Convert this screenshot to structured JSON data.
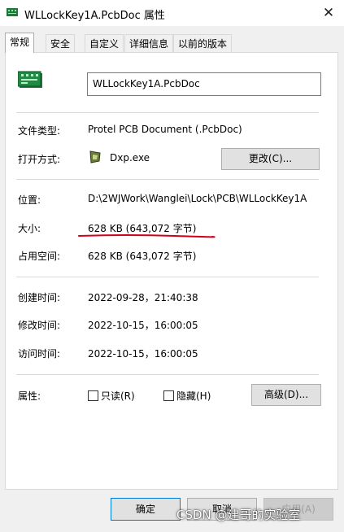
{
  "window": {
    "title": "WLLockKey1A.PcbDoc 属性",
    "close_glyph": "✕"
  },
  "tabs": [
    {
      "label": "常规"
    },
    {
      "label": "安全"
    },
    {
      "label": "自定义"
    },
    {
      "label": "详细信息"
    },
    {
      "label": "以前的版本"
    }
  ],
  "file": {
    "name": "WLLockKey1A.PcbDoc",
    "icon": "pcb-document-icon"
  },
  "general": {
    "type_label": "文件类型:",
    "type_value": "Protel PCB Document (.PcbDoc)",
    "opens_with_label": "打开方式:",
    "opens_with_value": "Dxp.exe",
    "opens_with_icon": "dxp-app-icon",
    "change_button": "更改(C)...",
    "location_label": "位置:",
    "location_value": "D:\\2WJWork\\Wanglei\\Lock\\PCB\\WLLockKey1A",
    "size_label": "大小:",
    "size_value": "628 KB (643,072 字节)",
    "size_on_disk_label": "占用空间:",
    "size_on_disk_value": "628 KB (643,072 字节)",
    "created_label": "创建时间:",
    "created_value": "2022-09-28，21:40:38",
    "modified_label": "修改时间:",
    "modified_value": "2022-10-15，16:00:05",
    "accessed_label": "访问时间:",
    "accessed_value": "2022-10-15，16:00:05",
    "attributes_label": "属性:",
    "readonly_label": "只读(R)",
    "hidden_label": "隐藏(H)",
    "advanced_button": "高级(D)..."
  },
  "footer": {
    "ok": "确定",
    "cancel": "取消",
    "apply": "应用(A)"
  },
  "annotation": {
    "underline_color": "#d0021b"
  },
  "watermark": "CSDN @建哥的实验室"
}
